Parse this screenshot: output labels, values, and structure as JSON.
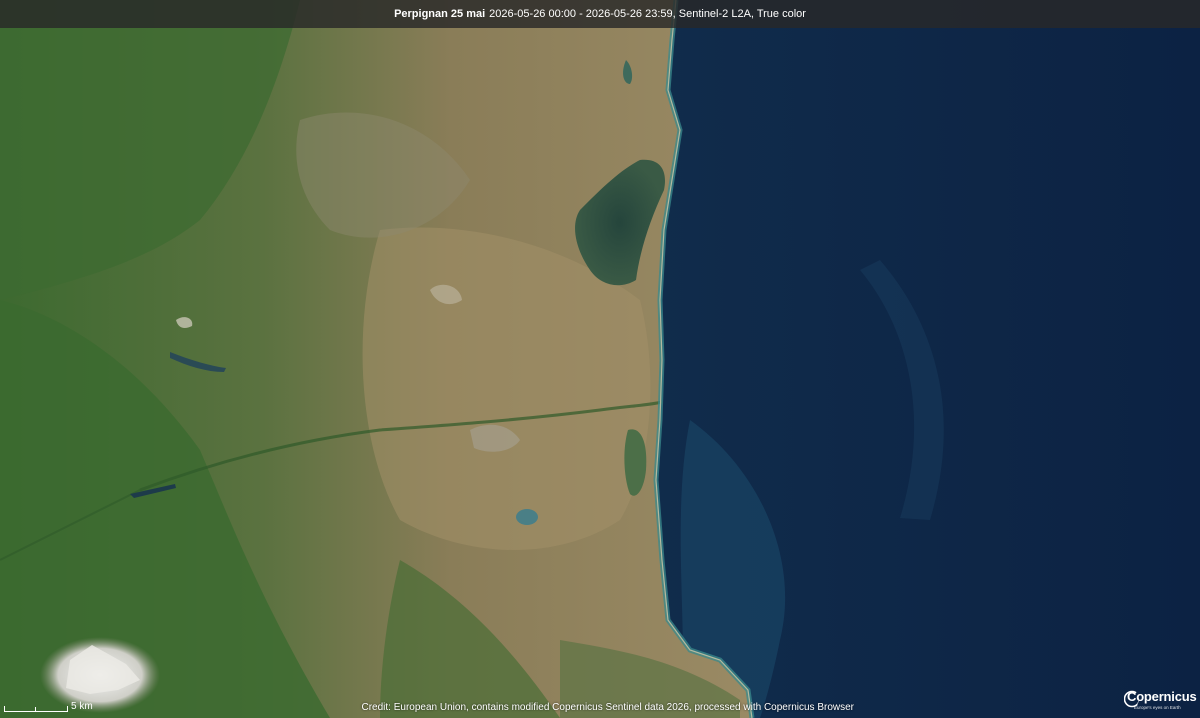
{
  "header": {
    "place": "Perpignan 25 mai",
    "details": "2026-05-26 00:00 - 2026-05-26 23:59, Sentinel-2 L2A, True color"
  },
  "scale": {
    "label": "5 km"
  },
  "credit": {
    "text": "Credit: European Union, contains modified Copernicus Sentinel data 2026, processed with Copernicus Browser"
  },
  "logo": {
    "word": "Copernicus",
    "tagline": "Europe's eyes on Earth"
  },
  "colors": {
    "sea_deep": "#0d2547",
    "sea_coast": "#1f5a7a",
    "land_green": "#3f6b34",
    "land_tan": "#9a8a66",
    "snow": "#e8e8e8"
  }
}
